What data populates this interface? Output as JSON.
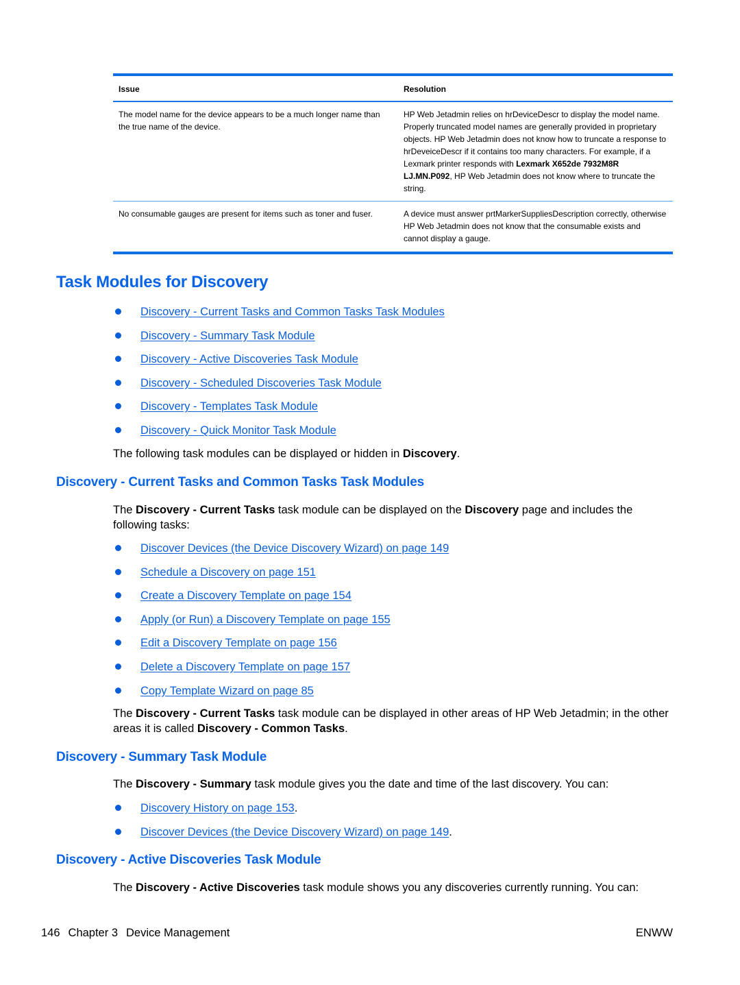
{
  "table": {
    "headers": [
      "Issue",
      "Resolution"
    ],
    "rows": [
      {
        "issue": "The model name for the device appears to be a much longer name than the true name of the device.",
        "resolution_before": "HP Web Jetadmin relies on hrDeviceDescr to display the model name. Properly truncated model names are generally provided in proprietary objects. HP Web Jetadmin does not know how to truncate a response to hrDeveiceDescr if it contains too many characters. For example, if a Lexmark printer responds with ",
        "resolution_bold": "Lexmark X652de 7932M8R LJ.MN.P092",
        "resolution_after": ", HP Web Jetadmin does not know where to truncate the string."
      },
      {
        "issue": "No consumable gauges are present for items such as toner and fuser.",
        "resolution_before": "A device must answer prtMarkerSuppliesDescription correctly, otherwise HP Web Jetadmin does not know that the consumable exists and cannot display a gauge.",
        "resolution_bold": "",
        "resolution_after": ""
      }
    ]
  },
  "section_main": {
    "title": "Task Modules for Discovery",
    "links": [
      "Discovery - Current Tasks and Common Tasks Task Modules",
      "Discovery - Summary Task Module",
      "Discovery - Active Discoveries Task Module",
      "Discovery - Scheduled Discoveries Task Module",
      "Discovery - Templates Task Module",
      "Discovery - Quick Monitor Task Module"
    ],
    "para": {
      "text": "The following task modules can be displayed or hidden in ",
      "bold": "Discovery",
      "end": "."
    }
  },
  "section_current": {
    "title": "Discovery - Current Tasks and Common Tasks Task Modules",
    "intro": {
      "t1": "The ",
      "b1": "Discovery - Current Tasks",
      "t2": " task module can be displayed on the ",
      "b2": "Discovery",
      "t3": " page and includes the following tasks:"
    },
    "links": [
      "Discover Devices (the Device Discovery Wizard) on page 149",
      "Schedule a Discovery on page 151",
      "Create a Discovery Template on page 154",
      "Apply (or Run) a Discovery Template on page 155",
      "Edit a Discovery Template on page 156",
      "Delete a Discovery Template on page 157",
      "Copy Template Wizard on page 85"
    ],
    "outro": {
      "t1": "The ",
      "b1": "Discovery - Current Tasks",
      "t2": " task module can be displayed in other areas of HP Web Jetadmin; in the other areas it is called ",
      "b2": "Discovery - Common Tasks",
      "t3": "."
    }
  },
  "section_summary": {
    "title": "Discovery - Summary Task Module",
    "intro": {
      "t1": "The ",
      "b1": "Discovery - Summary",
      "t2": " task module gives you the date and time of the last discovery. You can:"
    },
    "links": [
      "Discovery History on page 153",
      "Discover Devices (the Device Discovery Wizard) on page 149"
    ],
    "link_suffix": "."
  },
  "section_active": {
    "title": "Discovery - Active Discoveries Task Module",
    "intro": {
      "t1": "The ",
      "b1": "Discovery - Active Discoveries",
      "t2": " task module shows you any discoveries currently running. You can:"
    }
  },
  "footer": {
    "page_number": "146",
    "chapter": "Chapter 3",
    "chapter_title": "Device Management",
    "locale": "ENWW"
  }
}
